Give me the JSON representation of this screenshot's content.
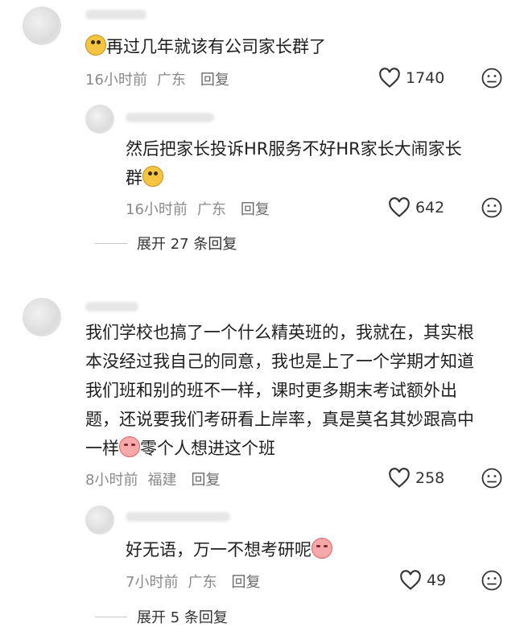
{
  "comments": [
    {
      "text_before": "",
      "text_after": "再过几年就该有公司家长群了",
      "lead_emoji": "bear-emoji",
      "time": "16小时前",
      "location": "广东",
      "reply": "回复",
      "likes": "1740",
      "reply_item": {
        "line1": "然后把家长投诉HR服务不好HR家长大闹家长",
        "line2": "群",
        "emoji": "bear-emoji",
        "time": "16小时前",
        "location": "广东",
        "reply": "回复",
        "likes": "642"
      },
      "expand": "展开 27 条回复"
    },
    {
      "lines": [
        "我们学校也搞了一个什么精英班的，我就在，其实根",
        "本没经过我自己的同意，我也是上了一个学期才知道",
        "我们班和别的班不一样，课时更多期末考试额外出",
        "题，还说要我们考研看上岸率，真是莫名其妙跟高中"
      ],
      "last_line_before": "一样",
      "last_line_after": "零个人想进这个班",
      "emoji": "cry-emoji",
      "time": "8小时前",
      "location": "福建",
      "reply": "回复",
      "likes": "258",
      "reply_item": {
        "text": "好无语，万一不想考研呢",
        "emoji": "cry-emoji",
        "time": "7小时前",
        "location": "广东",
        "reply": "回复",
        "likes": "49"
      },
      "expand": "展开 5 条回复"
    }
  ],
  "icons": {
    "like": "heart-outline-icon",
    "dislike": "sad-face-icon"
  },
  "colors": {
    "meta": "#8a8a8a",
    "text": "#1f1f1f",
    "icon": "#333333"
  }
}
